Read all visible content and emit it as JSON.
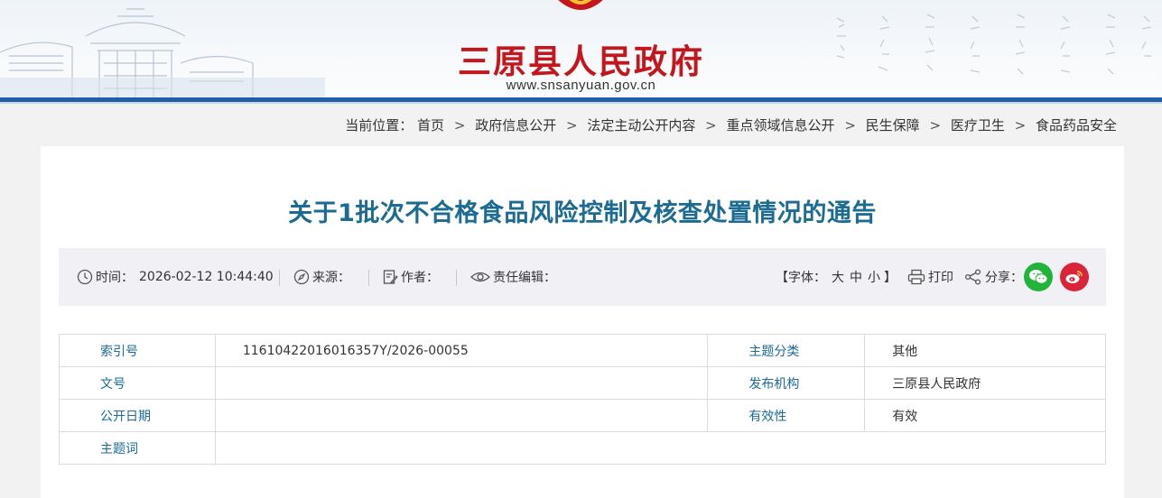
{
  "header": {
    "site_name": "三原县人民政府",
    "site_url": "www.snsanyuan.gov.cn",
    "brand_color": "#c4161c",
    "stripe_color": "#1f5fa6"
  },
  "breadcrumb": {
    "prefix": "当前位置：",
    "separator": ">",
    "items": [
      "首页",
      "政府信息公开",
      "法定主动公开内容",
      "重点领域信息公开",
      "民生保障",
      "医疗卫生",
      "食品药品安全"
    ]
  },
  "article": {
    "title": "关于1批次不合格食品风险控制及核查处置情况的通告",
    "title_color": "#1b6b93"
  },
  "meta": {
    "time_label": "时间：",
    "time_value": "2026-02-12 10:44:40",
    "source_label": "来源：",
    "author_label": "作者：",
    "editor_label": "责任编辑：",
    "font_size_label": "【字体：",
    "font_large": "大",
    "font_medium": "中",
    "font_small": "小",
    "font_size_close": "】",
    "print_label": "打印",
    "share_label": "分享：",
    "icons": [
      "clock-icon",
      "compass-icon",
      "pen-icon",
      "eye-icon",
      "printer-icon",
      "share-icon",
      "wechat-icon",
      "weibo-icon"
    ],
    "wechat_color": "#21b33a",
    "weibo_color": "#d9243a"
  },
  "info_table": {
    "rows": [
      {
        "label1": "索引号",
        "value1": "11610422016016357Y/2026-00055",
        "label2": "主题分类",
        "value2": "其他"
      },
      {
        "label1": "文号",
        "value1": "",
        "label2": "发布机构",
        "value2": "三原县人民政府"
      },
      {
        "label1": "公开日期",
        "value1": "",
        "label2": "有效性",
        "value2": "有效"
      },
      {
        "label1": "主题词",
        "value1": ""
      }
    ]
  }
}
